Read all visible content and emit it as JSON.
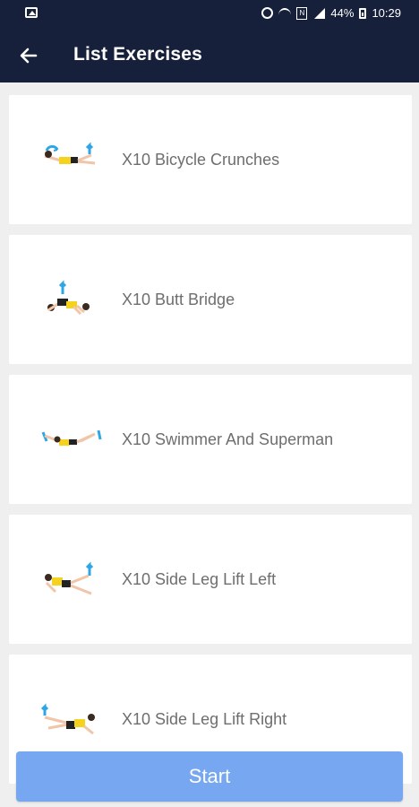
{
  "statusbar": {
    "battery": "44%",
    "time": "10:29",
    "icons": [
      "image-icon",
      "alarm-icon",
      "wifi-icon",
      "nfc-icon",
      "signal-icon",
      "battery-icon"
    ]
  },
  "appbar": {
    "title": "List Exercises",
    "back_icon": "back-arrow-icon"
  },
  "exercises": [
    {
      "label": "X10 Bicycle Crunches"
    },
    {
      "label": "X10 Butt Bridge"
    },
    {
      "label": "X10 Swimmer And Superman"
    },
    {
      "label": "X10 Side Leg Lift Left"
    },
    {
      "label": "X10 Side Leg Lift Right"
    }
  ],
  "start_label": "Start",
  "colors": {
    "appbar": "#16203a",
    "accent": "#76a7f0",
    "arrow": "#2ea6e6",
    "shirt": "#f5d21e"
  }
}
